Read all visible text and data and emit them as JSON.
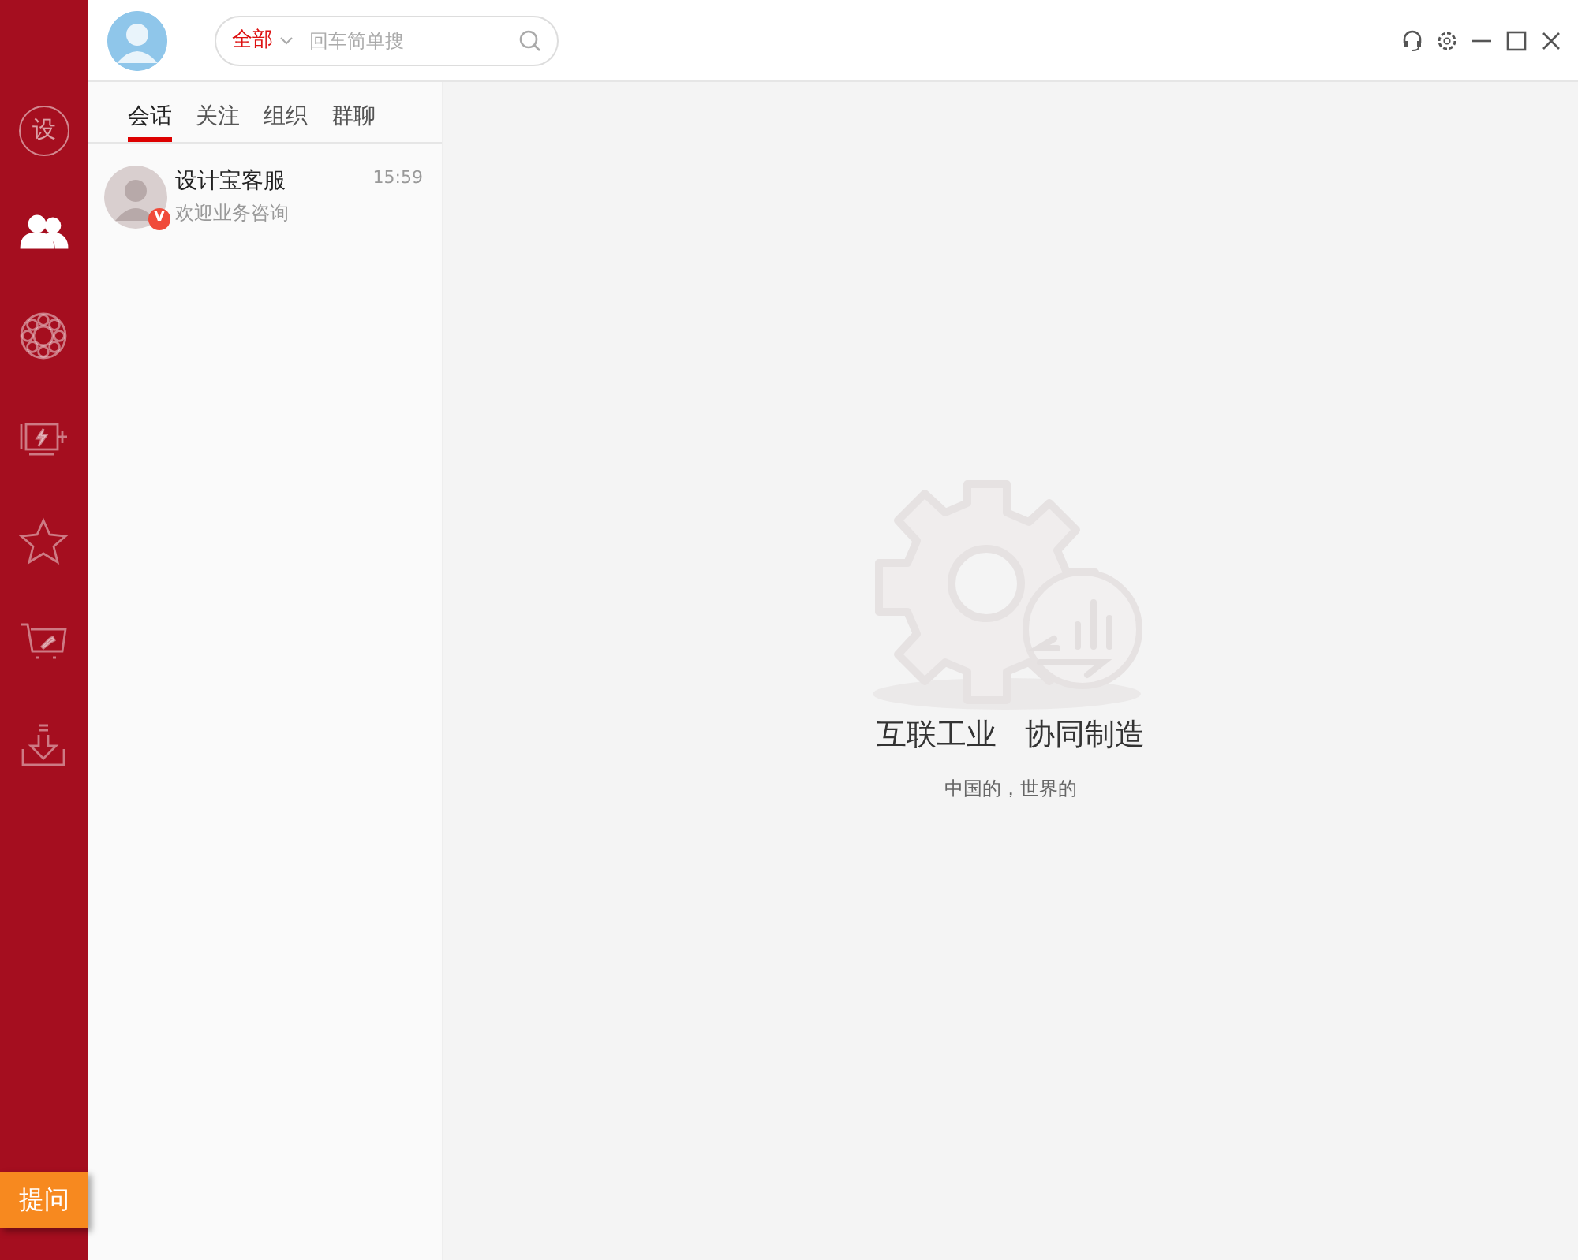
{
  "sidebar": {
    "items": [
      {
        "kind": "logo",
        "label": "设",
        "selected": false
      },
      {
        "kind": "contacts",
        "selected": true
      },
      {
        "kind": "bearing",
        "selected": false
      },
      {
        "kind": "motor",
        "selected": false
      },
      {
        "kind": "star",
        "selected": false
      },
      {
        "kind": "cart",
        "selected": false
      },
      {
        "kind": "download",
        "selected": false
      }
    ],
    "help_button": "提问"
  },
  "search": {
    "scope": "全部",
    "placeholder": "回车简单搜"
  },
  "tabs": [
    {
      "label": "会话",
      "selected": true
    },
    {
      "label": "关注",
      "selected": false
    },
    {
      "label": "组织",
      "selected": false
    },
    {
      "label": "群聊",
      "selected": false
    }
  ],
  "conversations": [
    {
      "name": "设计宝客服",
      "time": "15:59",
      "message": "欢迎业务咨询",
      "badge": "V"
    }
  ],
  "empty_state": {
    "headline": [
      "互联工业",
      "协同制造"
    ],
    "subtitle": "中国的，世界的"
  }
}
